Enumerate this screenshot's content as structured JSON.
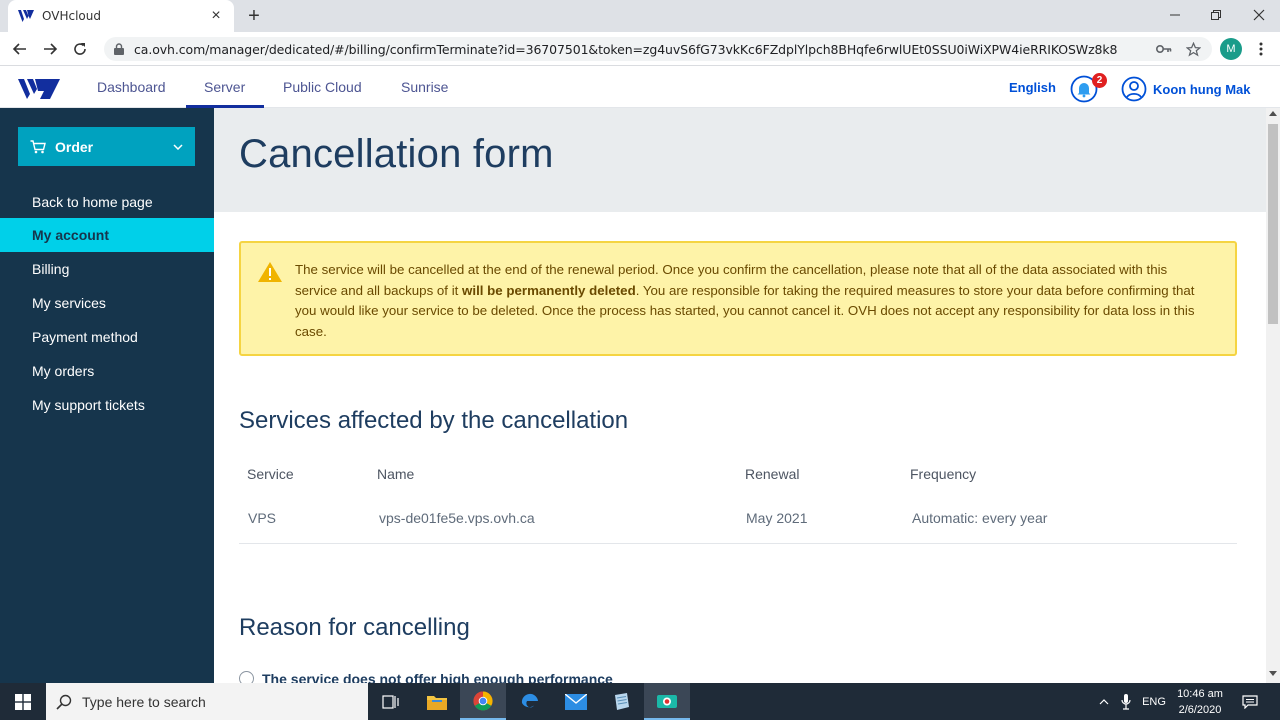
{
  "browser": {
    "tab_title": "OVHcloud",
    "tab_close": "×",
    "new_tab": "+",
    "url": "ca.ovh.com/manager/dedicated/#/billing/confirmTerminate?id=36707501&token=zg4uvS6fG73vkKc6FZdplYlpch8BHqfe6rwlUEt0SSU0iWiXPW4ieRRIKOSWz8k8",
    "profile_initial": "M"
  },
  "header": {
    "nav": [
      "Dashboard",
      "Server",
      "Public Cloud",
      "Sunrise"
    ],
    "active_nav": "Server",
    "language": "English",
    "notifications_count": "2",
    "user_name": "Koon hung Mak"
  },
  "sidebar": {
    "order_label": "Order",
    "items": [
      {
        "label": "Back to home page",
        "active": false
      },
      {
        "label": "My account",
        "active": true
      },
      {
        "label": "Billing",
        "active": false
      },
      {
        "label": "My services",
        "active": false
      },
      {
        "label": "Payment method",
        "active": false
      },
      {
        "label": "My orders",
        "active": false
      },
      {
        "label": "My support tickets",
        "active": false
      }
    ]
  },
  "main": {
    "page_title": "Cancellation form",
    "warning": {
      "text_before": "The service will be cancelled at the end of the renewal period. Once you confirm the cancellation, please note that all of the data associated with this service and all backups of it ",
      "text_bold": "will be permanently deleted",
      "text_after": ". You are responsible for taking the required measures to store your data before confirming that you would like your service to be deleted. Once the process has started, you cannot cancel it. OVH does not accept any responsibility for data loss in this case."
    },
    "services_title": "Services affected by the cancellation",
    "table": {
      "headers": [
        "Service",
        "Name",
        "Renewal",
        "Frequency"
      ],
      "rows": [
        [
          "VPS",
          "vps-de01fe5e.vps.ovh.ca",
          "May 2021",
          "Automatic: every year"
        ]
      ]
    },
    "reason_title": "Reason for cancelling",
    "reason_option_1": "The service does not offer high enough performance"
  },
  "taskbar": {
    "search_placeholder": "Type here to search",
    "language": "ENG",
    "time": "10:46 am",
    "date": "2/6/2020"
  },
  "colors": {
    "sidebar_bg": "#16354c",
    "order_btn": "#00a2bf",
    "active_item": "#00d0e9",
    "warning_bg": "#fef3a8",
    "warning_border": "#f5d442",
    "title_color": "#1e3d60",
    "link_blue": "#0050d7"
  },
  "icons": [
    "ovh-logo-icon",
    "back-arrow-icon",
    "forward-arrow-icon",
    "reload-icon",
    "lock-icon",
    "key-icon",
    "star-icon",
    "bell-icon",
    "user-icon",
    "cart-icon",
    "chevron-down-icon",
    "warning-icon",
    "windows-start-icon",
    "search-icon",
    "task-view-icon",
    "file-explorer-icon",
    "chrome-icon",
    "edge-icon",
    "mail-icon",
    "notepad-icon",
    "camera-icon",
    "chevron-up-icon",
    "microphone-icon",
    "notification-center-icon"
  ]
}
